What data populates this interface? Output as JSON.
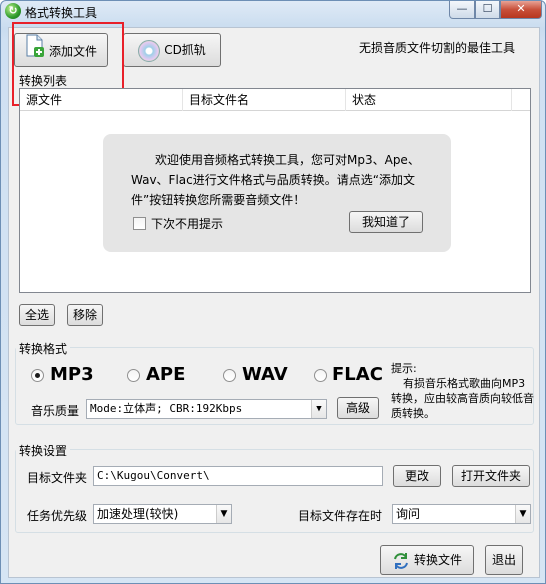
{
  "window": {
    "title": "格式转换工具",
    "icon": "app-logo-icon",
    "controls": {
      "minimize": "—",
      "maximize": "☐",
      "close": "✕"
    }
  },
  "toolbar": {
    "add_file_label": "添加文件",
    "cd_rip_label": "CD抓轨",
    "slogan": "无损音质文件切割的最佳工具"
  },
  "list": {
    "section_title": "转换列表",
    "columns": [
      "源文件",
      "目标文件名",
      "状态"
    ],
    "tip": {
      "message": "欢迎使用音频格式转换工具，您可对Mp3、Ape、Wav、Flac进行文件格式与品质转换。请点选“添加文件”按钮转换您所需要音频文件！",
      "dont_show_label": "下次不用提示",
      "ok_label": "我知道了"
    },
    "select_all_label": "全选",
    "remove_label": "移除"
  },
  "format": {
    "section_title": "转换格式",
    "options": [
      "MP3",
      "APE",
      "WAV",
      "FLAC"
    ],
    "selected": "MP3",
    "quality_label": "音乐质量",
    "quality_value": "Mode:立体声; CBR:192Kbps",
    "advanced_label": "高级",
    "hint_title": "提示:",
    "hint_text": "有损音乐格式歌曲向MP3转换，应由较高音质向较低音质转换。"
  },
  "settings": {
    "section_title": "转换设置",
    "target_folder_label": "目标文件夹",
    "target_folder_value": "C:\\Kugou\\Convert\\",
    "change_label": "更改",
    "open_folder_label": "打开文件夹",
    "priority_label": "任务优先级",
    "priority_value": "加速处理(较快)",
    "exists_label": "目标文件存在时",
    "exists_value": "询问"
  },
  "actions": {
    "convert_label": "转换文件",
    "exit_label": "退出"
  },
  "colors": {
    "highlight_box": "#e8202a",
    "client_bg": "#f0f0f0",
    "tip_bg": "#e5e5e5"
  }
}
